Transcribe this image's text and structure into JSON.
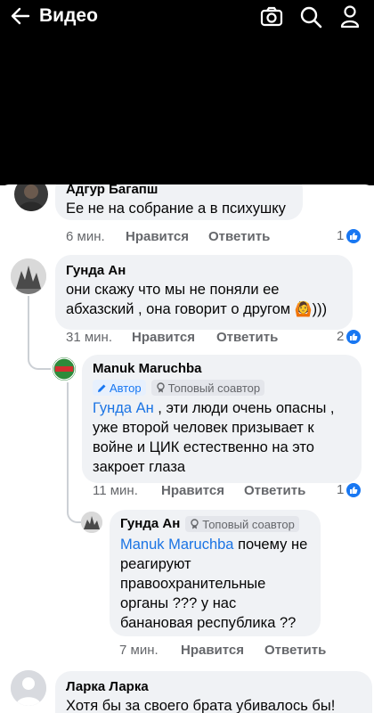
{
  "header": {
    "title": "Видео"
  },
  "comments": [
    {
      "author": "Адгур Багапш",
      "text": "Ее не на собрание а в психушку",
      "time": "6 мин.",
      "like_label": "Нравится",
      "reply_label": "Ответить",
      "likes": "1"
    },
    {
      "author": "Гунда Ан",
      "text": "они скажу что мы не поняли ее абхазский , она говорит о другом",
      "emoji": "🙆",
      "suffix": ")))",
      "time": "31 мин.",
      "like_label": "Нравится",
      "reply_label": "Ответить",
      "likes": "2"
    },
    {
      "author": "Manuk Maruchba",
      "badge_author": "Автор",
      "badge_top": "Топовый соавтор",
      "mention": "Гунда Ан",
      "text": " , эти люди очень опасны , уже второй человек призывает к войне и ЦИК естественно на это закроет глаза",
      "time": "11 мин.",
      "like_label": "Нравится",
      "reply_label": "Ответить",
      "likes": "1"
    },
    {
      "author": "Гунда Ан",
      "badge_top": "Топовый соавтор",
      "mention": "Manuk Maruchba",
      "text": " почему не реагируют правоохранительные органы ??? у нас банановая республика ??",
      "time": "7 мин.",
      "like_label": "Нравится",
      "reply_label": "Ответить"
    },
    {
      "author": "Ларка Ларка",
      "text": "Хотя бы за своего брата убивалось бы!"
    }
  ],
  "colors": {
    "accent": "#1877f2",
    "bubble": "#f0f2f5",
    "meta": "#65676b"
  }
}
